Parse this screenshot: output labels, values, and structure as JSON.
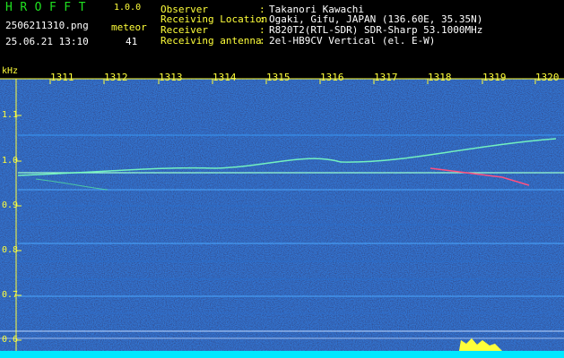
{
  "header": {
    "app_name": "HROFFT",
    "version": "1.0.0",
    "filename": "2506211310.png",
    "datetime": "25.06.21 13:10",
    "meteor_label": "meteor",
    "meteor_count": "41",
    "info": [
      {
        "label": "Observer",
        "value": "Takanori Kawachi"
      },
      {
        "label": "Receiving Location",
        "value": "Ogaki, Gifu, JAPAN (136.60E, 35.35N)"
      },
      {
        "label": "Receiver",
        "value": "R820T2(RTL-SDR) SDR-Sharp 53.1000MHz"
      },
      {
        "label": "Receiving antenna",
        "value": "2el-HB9CV Vertical (el. E-W)"
      }
    ],
    "separator": ":"
  },
  "plot": {
    "y_unit": "kHz",
    "x_ticks": [
      "1311",
      "1312",
      "1313",
      "1314",
      "1315",
      "1316",
      "1317",
      "1318",
      "1319",
      "1320"
    ],
    "y_ticks": [
      "1.1",
      "1.0",
      "0.9",
      "0.8",
      "0.7",
      "0.6"
    ],
    "colors": {
      "background": "#000033",
      "axis": "#ffff3a",
      "level": "#00e8ff"
    }
  }
}
